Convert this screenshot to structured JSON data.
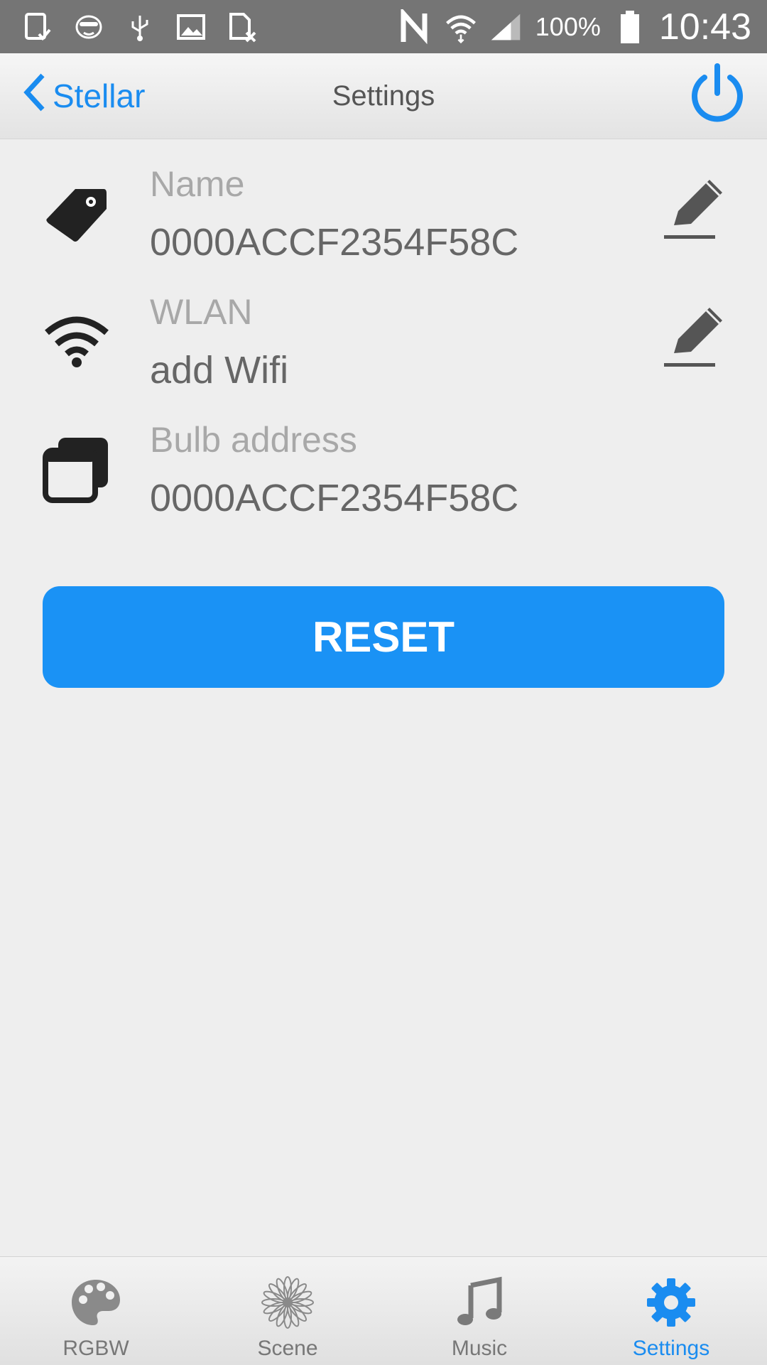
{
  "status_bar": {
    "battery": "100%",
    "time": "10:43",
    "icons": [
      "tablet-check-icon",
      "mask-icon",
      "usb-icon",
      "image-icon",
      "sim-off-icon",
      "nfc-icon",
      "wifi-icon",
      "signal-icon",
      "battery-icon"
    ]
  },
  "nav": {
    "back_label": "Stellar",
    "title": "Settings",
    "power_icon": "power-icon"
  },
  "settings": {
    "name": {
      "label": "Name",
      "value": "0000ACCF2354F58C",
      "icon": "tag-icon",
      "editable": true
    },
    "wlan": {
      "label": "WLAN",
      "value": "add Wifi",
      "icon": "wifi-icon",
      "editable": true
    },
    "bulb_address": {
      "label": "Bulb address",
      "value": "0000ACCF2354F58C",
      "icon": "windows-icon",
      "editable": false
    }
  },
  "reset_label": "RESET",
  "tabs": [
    {
      "label": "RGBW",
      "icon": "palette-icon",
      "active": false
    },
    {
      "label": "Scene",
      "icon": "flower-icon",
      "active": false
    },
    {
      "label": "Music",
      "icon": "music-note-icon",
      "active": false
    },
    {
      "label": "Settings",
      "icon": "gear-icon",
      "active": true
    }
  ],
  "colors": {
    "accent": "#1a8cf0",
    "button": "#1a92f5",
    "status_bar": "#757575",
    "background": "#eeeeee"
  }
}
